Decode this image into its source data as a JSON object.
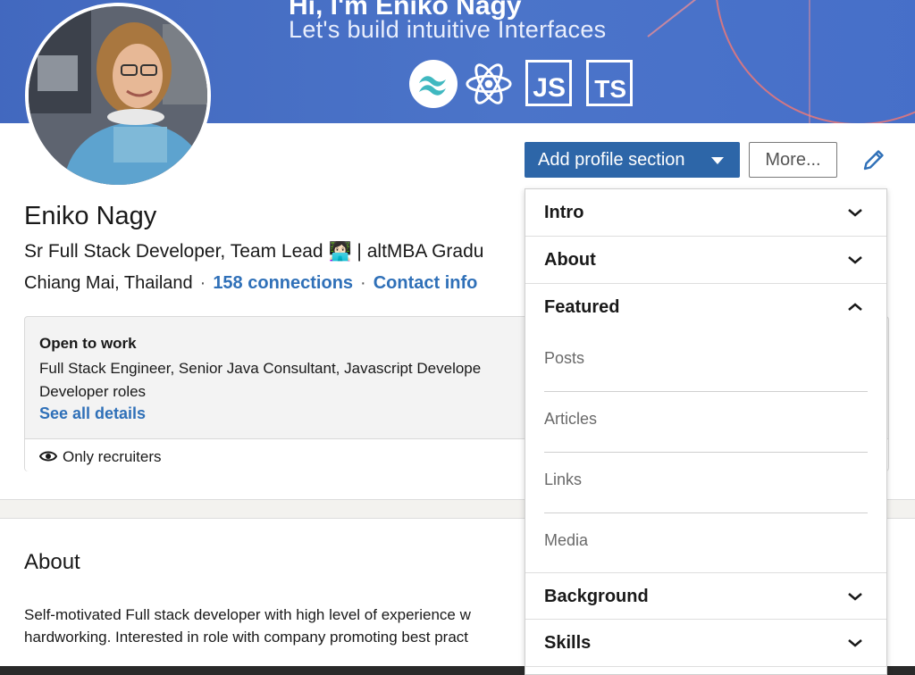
{
  "banner": {
    "title": "Hi, I'm Eniko Nagy",
    "subtitle": "Let's build intuitive Interfaces",
    "tech_icons": [
      "tailwind-icon",
      "react-icon",
      "javascript-icon",
      "typescript-icon"
    ],
    "js_label": "JS",
    "ts_label": "TS",
    "color": "#4b74c9"
  },
  "profile": {
    "name": "Eniko Nagy",
    "headline": "Sr Full Stack Developer, Team Lead 👩🏻‍💻 | altMBA Gradu",
    "location": "Chiang Mai, Thailand",
    "separator": "·",
    "connections": "158 connections",
    "contact": "Contact info"
  },
  "actions": {
    "add_section": "Add profile section",
    "more": "More..."
  },
  "open_to_work": {
    "title": "Open to work",
    "description": "Full Stack Engineer, Senior Java Consultant, Javascript Develope Developer roles",
    "link": "See all details",
    "visibility": "Only recruiters"
  },
  "about": {
    "title": "About",
    "line1": "Self-motivated Full stack developer with high level of experience w",
    "line2": "hardworking. Interested in role with company promoting best pract"
  },
  "dropdown": {
    "intro": "Intro",
    "about": "About",
    "featured": "Featured",
    "featured_items": [
      "Posts",
      "Articles",
      "Links",
      "Media"
    ],
    "background": "Background",
    "skills": "Skills"
  },
  "colors": {
    "primary": "#2d66a8",
    "link": "#2f70b8"
  }
}
